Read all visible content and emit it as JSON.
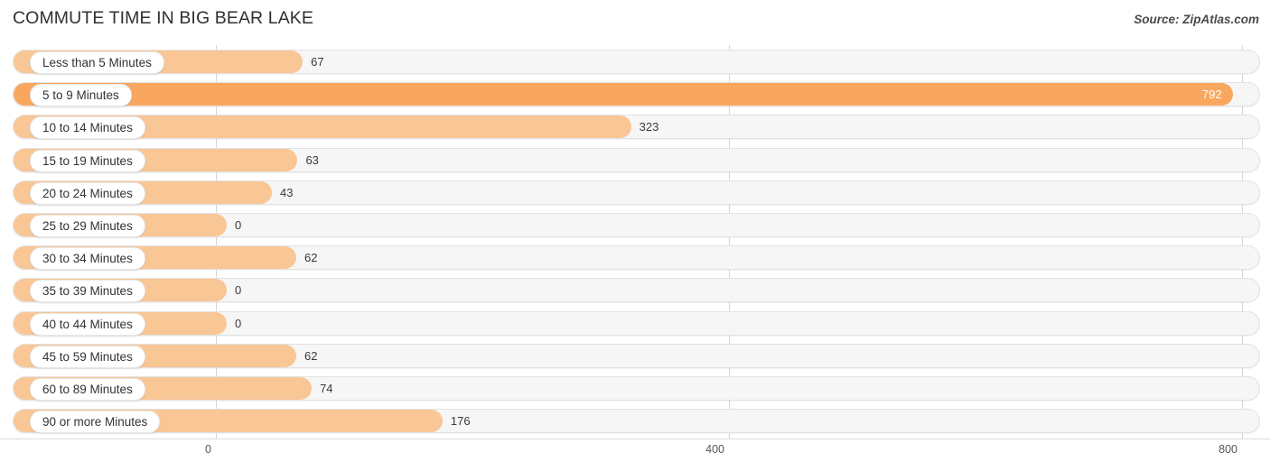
{
  "header": {
    "title": "COMMUTE TIME IN BIG BEAR LAKE",
    "source": "Source: ZipAtlas.com"
  },
  "colors": {
    "bar": "#f9c695",
    "bar_highlight": "#f9a75f",
    "track": "#f6f6f6",
    "track_border": "#e2e2e2",
    "gridline": "#d6d6d6",
    "text": "#3a3a3a",
    "inside_label": "#ffffff"
  },
  "chart_data": {
    "type": "bar",
    "orientation": "horizontal",
    "title": "COMMUTE TIME IN BIG BEAR LAKE",
    "xlabel": "",
    "ylabel": "",
    "xlim": [
      0,
      800
    ],
    "ticks": [
      "0",
      "400",
      "800"
    ],
    "tick_values": [
      0,
      400,
      800
    ],
    "grid": true,
    "legend": false,
    "categories": [
      "Less than 5 Minutes",
      "5 to 9 Minutes",
      "10 to 14 Minutes",
      "15 to 19 Minutes",
      "20 to 24 Minutes",
      "25 to 29 Minutes",
      "30 to 34 Minutes",
      "35 to 39 Minutes",
      "40 to 44 Minutes",
      "45 to 59 Minutes",
      "60 to 89 Minutes",
      "90 or more Minutes"
    ],
    "values": [
      67,
      792,
      323,
      63,
      43,
      0,
      62,
      0,
      0,
      62,
      74,
      176
    ],
    "value_labels": [
      "67",
      "792",
      "323",
      "63",
      "43",
      "0",
      "62",
      "0",
      "0",
      "62",
      "74",
      "176"
    ],
    "highlight_index": 1
  },
  "axis": {
    "t0": "0",
    "t1": "400",
    "t2": "800"
  },
  "rows": [
    {
      "label": "Less than 5 Minutes",
      "value": "67"
    },
    {
      "label": "5 to 9 Minutes",
      "value": "792"
    },
    {
      "label": "10 to 14 Minutes",
      "value": "323"
    },
    {
      "label": "15 to 19 Minutes",
      "value": "63"
    },
    {
      "label": "20 to 24 Minutes",
      "value": "43"
    },
    {
      "label": "25 to 29 Minutes",
      "value": "0"
    },
    {
      "label": "30 to 34 Minutes",
      "value": "62"
    },
    {
      "label": "35 to 39 Minutes",
      "value": "0"
    },
    {
      "label": "40 to 44 Minutes",
      "value": "0"
    },
    {
      "label": "45 to 59 Minutes",
      "value": "62"
    },
    {
      "label": "60 to 89 Minutes",
      "value": "74"
    },
    {
      "label": "90 or more Minutes",
      "value": "176"
    }
  ]
}
